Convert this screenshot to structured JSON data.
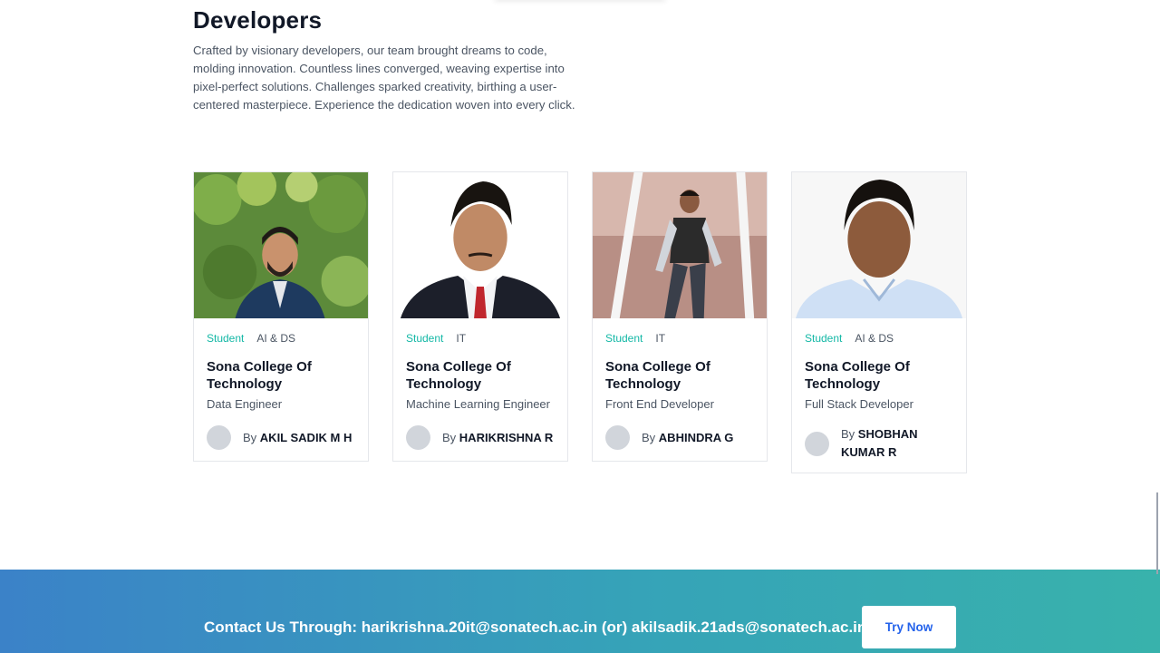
{
  "section": {
    "title": "Developers",
    "description": "Crafted by visionary developers, our team brought dreams to code, molding innovation. Countless lines converged, weaving expertise into pixel-perfect solutions. Challenges sparked creativity, birthing a user-centered masterpiece. Experience the dedication woven into every click."
  },
  "developers": [
    {
      "role": "Student",
      "dept": "AI & DS",
      "college": "Sona College Of Technology",
      "position": "Data Engineer",
      "by": "By",
      "name": "AKIL SADIK M H"
    },
    {
      "role": "Student",
      "dept": "IT",
      "college": "Sona College Of Technology",
      "position": "Machine Learning Engineer",
      "by": "By",
      "name": "HARIKRISHNA R"
    },
    {
      "role": "Student",
      "dept": "IT",
      "college": "Sona College Of Technology",
      "position": "Front End Developer",
      "by": "By",
      "name": "ABHINDRA G"
    },
    {
      "role": "Student",
      "dept": "AI & DS",
      "college": "Sona College Of Technology",
      "position": "Full Stack Developer",
      "by": "By",
      "name": "SHOBHAN KUMAR R"
    }
  ],
  "footer": {
    "contact": "Contact Us Through: harikrishna.20it@sonatech.ac.in (or) akilsadik.21ads@sonatech.ac.in",
    "button_label": "Try Now"
  },
  "colors": {
    "accent_teal": "#14b8a6",
    "footer_gradient_start": "#3b82c8",
    "footer_gradient_end": "#38b2ac",
    "button_text": "#2563eb"
  }
}
